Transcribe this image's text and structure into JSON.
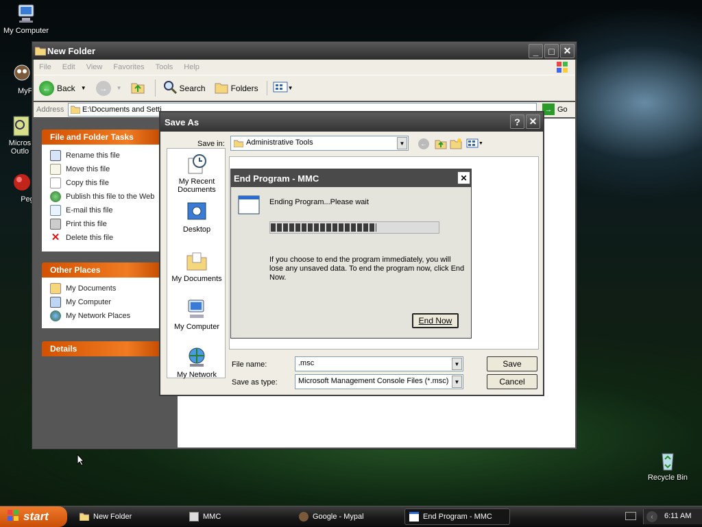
{
  "desktop": {
    "icons": [
      {
        "label": "My Computer"
      },
      {
        "label": "MyPa"
      },
      {
        "label": "Micros Outlo"
      },
      {
        "label": "Peg"
      },
      {
        "label": "Recycle Bin"
      }
    ]
  },
  "explorer": {
    "title": "New Folder",
    "menu": [
      "File",
      "Edit",
      "View",
      "Favorites",
      "Tools",
      "Help"
    ],
    "toolbar": {
      "back": "Back",
      "search": "Search",
      "folders": "Folders"
    },
    "address_label": "Address",
    "address_value": "E:\\Documents and Setti",
    "go_label": "Go",
    "file_folder_tasks": {
      "title": "File and Folder Tasks",
      "items": [
        "Rename this file",
        "Move this file",
        "Copy this file",
        "Publish this file to the Web",
        "E-mail this file",
        "Print this file",
        "Delete this file"
      ]
    },
    "other_places": {
      "title": "Other Places",
      "items": [
        "My Documents",
        "My Computer",
        "My Network Places"
      ]
    },
    "details": {
      "title": "Details"
    }
  },
  "save_as": {
    "title": "Save As",
    "save_in_label": "Save in:",
    "save_in_value": "Administrative Tools",
    "places": [
      "My Recent Documents",
      "Desktop",
      "My Documents",
      "My Computer",
      "My Network"
    ],
    "file_name_label": "File name:",
    "file_name_value": ".msc",
    "save_as_type_label": "Save as type:",
    "save_as_type_value": "Microsoft Management Console Files (*.msc)",
    "save_button": "Save",
    "cancel_button": "Cancel"
  },
  "end_program": {
    "title": "End Program - MMC",
    "status": "Ending Program...Please wait",
    "progress": 0.63,
    "message": "If you choose to end the program immediately, you will lose any unsaved data. To end the program now, click End Now.",
    "end_now_button": "End Now"
  },
  "taskbar": {
    "start_label": "start",
    "tasks": [
      "New Folder",
      "MMC",
      "Google - Mypal",
      "End Program - MMC"
    ],
    "clock": "6:11 AM"
  },
  "colors": {
    "accent_orange": "#e8691a",
    "selection_blue": "#0a246a"
  }
}
